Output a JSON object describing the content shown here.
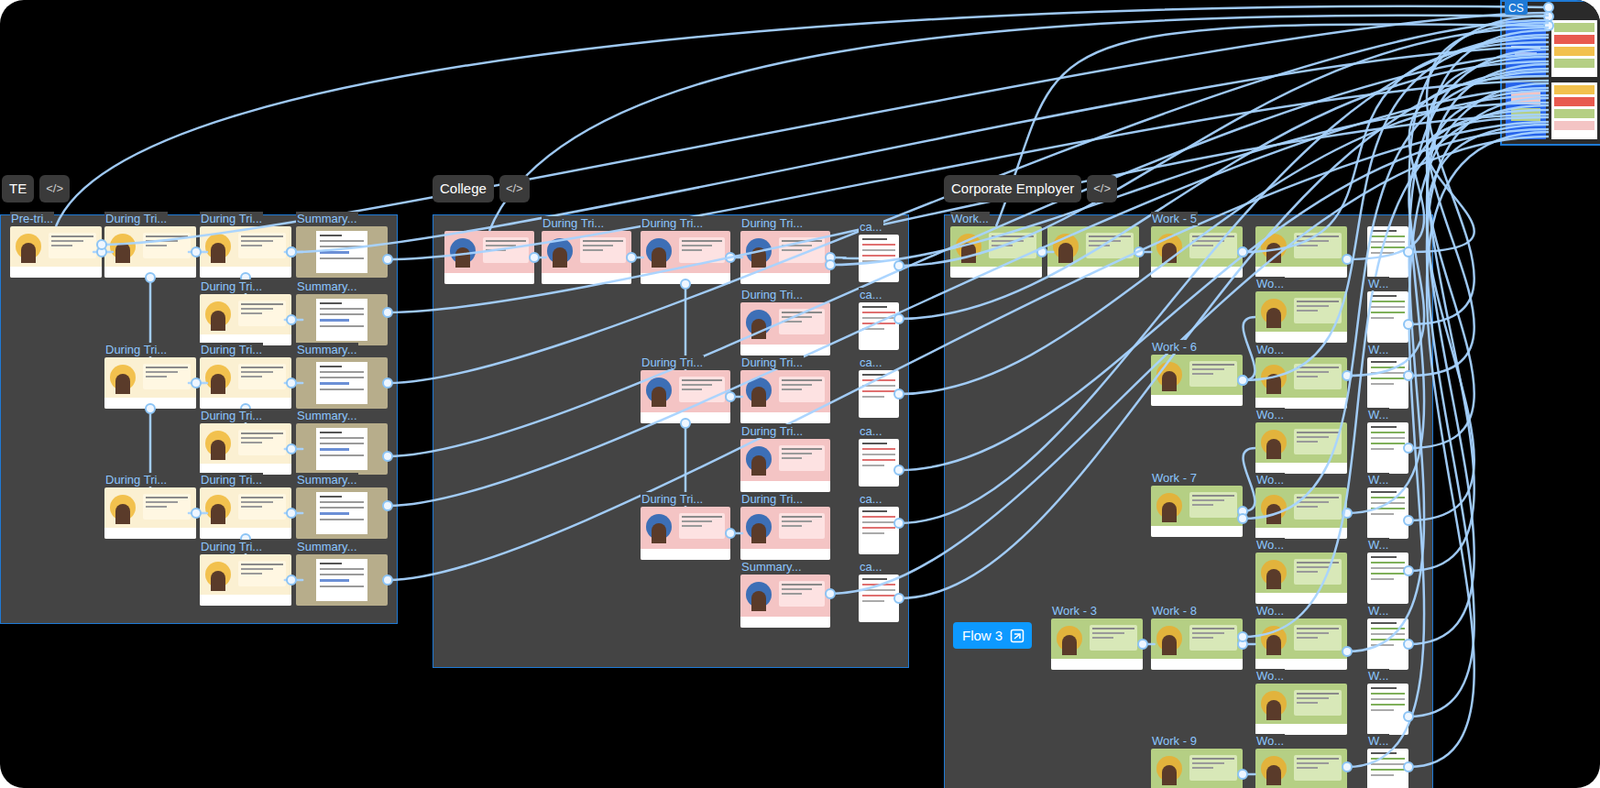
{
  "cs_frame": {
    "label": "CS"
  },
  "badge": {
    "label": "Flow 3"
  },
  "sections": [
    {
      "id": "te",
      "label": "TE",
      "code_icon": "</>",
      "frames": [
        {
          "label": "Pre-tri...",
          "kind": "scene"
        },
        {
          "label": "During Tri...",
          "kind": "scene"
        },
        {
          "label": "During Tri...",
          "kind": "scene"
        },
        {
          "label": "Summary...",
          "kind": "summary"
        },
        {
          "label": "During Tri...",
          "kind": "scene"
        },
        {
          "label": "Summary...",
          "kind": "summary"
        },
        {
          "label": "During Tri...",
          "kind": "scene"
        },
        {
          "label": "During Tri...",
          "kind": "scene"
        },
        {
          "label": "Summary...",
          "kind": "summary"
        },
        {
          "label": "During Tri...",
          "kind": "scene"
        },
        {
          "label": "Summary...",
          "kind": "summary"
        },
        {
          "label": "During Tri...",
          "kind": "scene"
        },
        {
          "label": "During Tri...",
          "kind": "scene"
        },
        {
          "label": "Summary...",
          "kind": "summary"
        },
        {
          "label": "During Tri...",
          "kind": "scene"
        },
        {
          "label": "Summary...",
          "kind": "summary"
        }
      ]
    },
    {
      "id": "college",
      "label": "College",
      "code_icon": "</>",
      "frames": [
        {
          "kind": "scene"
        },
        {
          "label": "During Tri...",
          "kind": "scene"
        },
        {
          "label": "During Tri...",
          "kind": "scene"
        },
        {
          "label": "During Tri...",
          "kind": "scene"
        },
        {
          "label": "ca...",
          "kind": "card"
        },
        {
          "label": "During Tri...",
          "kind": "scene"
        },
        {
          "label": "During Tri...",
          "kind": "scene"
        },
        {
          "label": "During Tri...",
          "kind": "scene"
        },
        {
          "label": "During Tri...",
          "kind": "scene"
        },
        {
          "label": "During Tri...",
          "kind": "scene"
        },
        {
          "label": "During Tri...",
          "kind": "scene"
        },
        {
          "label": "Summary...",
          "kind": "scene"
        },
        {
          "label": "ca...",
          "kind": "card"
        },
        {
          "label": "ca...",
          "kind": "card"
        },
        {
          "label": "ca...",
          "kind": "card"
        },
        {
          "label": "ca...",
          "kind": "card"
        },
        {
          "label": "ca...",
          "kind": "card"
        }
      ]
    },
    {
      "id": "corporate",
      "label": "Corporate Employer",
      "code_icon": "</>",
      "frames": [
        {
          "label": "Work...",
          "kind": "scene"
        },
        {
          "kind": "scene"
        },
        {
          "label": "Work - 5",
          "kind": "scene"
        },
        {
          "kind": "scene"
        },
        {
          "label": "Wo...",
          "kind": "scene"
        },
        {
          "label": "Wo...",
          "kind": "scene"
        },
        {
          "label": "Wo...",
          "kind": "scene"
        },
        {
          "label": "Wo...",
          "kind": "scene"
        },
        {
          "label": "Wo...",
          "kind": "scene"
        },
        {
          "label": "Wo...",
          "kind": "scene"
        },
        {
          "label": "Wo...",
          "kind": "scene"
        },
        {
          "label": "Wo...",
          "kind": "scene"
        },
        {
          "kind": "card"
        },
        {
          "label": "W...",
          "kind": "card"
        },
        {
          "label": "W...",
          "kind": "card"
        },
        {
          "label": "W...",
          "kind": "card"
        },
        {
          "label": "W...",
          "kind": "card"
        },
        {
          "label": "W...",
          "kind": "card"
        },
        {
          "label": "W...",
          "kind": "card"
        },
        {
          "label": "W...",
          "kind": "card"
        },
        {
          "label": "W...",
          "kind": "card"
        },
        {
          "label": "Work - 6",
          "kind": "scene"
        },
        {
          "label": "Work - 7",
          "kind": "scene"
        },
        {
          "label": "Work - 3",
          "kind": "scene"
        },
        {
          "label": "Work - 8",
          "kind": "scene"
        },
        {
          "label": "Work - 9",
          "kind": "scene"
        }
      ]
    }
  ],
  "connections": [
    {
      "from": "cs",
      "to": "te.0"
    },
    {
      "from": "cs",
      "to": "college.0"
    },
    {
      "from": "cs",
      "to": "corporate.0"
    },
    {
      "from": "te.0",
      "to": "te.1"
    },
    {
      "from": "te.1",
      "to": "te.2"
    },
    {
      "from": "te.2",
      "to": "te.3"
    },
    {
      "from": "te.2",
      "to": "te.4"
    },
    {
      "from": "te.4",
      "to": "te.5"
    },
    {
      "from": "te.1",
      "to": "te.6"
    },
    {
      "from": "te.6",
      "to": "te.7"
    },
    {
      "from": "te.7",
      "to": "te.8"
    },
    {
      "from": "te.7",
      "to": "te.9"
    },
    {
      "from": "te.9",
      "to": "te.10"
    },
    {
      "from": "te.6",
      "to": "te.11"
    },
    {
      "from": "te.11",
      "to": "te.12"
    },
    {
      "from": "te.12",
      "to": "te.13"
    },
    {
      "from": "te.12",
      "to": "te.14"
    },
    {
      "from": "te.14",
      "to": "te.15"
    },
    {
      "from": "college.0",
      "to": "college.1"
    },
    {
      "from": "college.1",
      "to": "college.2"
    },
    {
      "from": "college.2",
      "to": "college.3"
    },
    {
      "from": "college.3",
      "to": "college.4"
    },
    {
      "from": "college.2",
      "to": "college.6"
    },
    {
      "from": "college.6",
      "to": "college.7"
    },
    {
      "from": "college.6",
      "to": "college.9"
    },
    {
      "from": "college.9",
      "to": "college.10"
    },
    {
      "from": "corporate.0",
      "to": "corporate.1"
    },
    {
      "from": "corporate.1",
      "to": "corporate.2"
    },
    {
      "from": "corporate.2",
      "to": "corporate.3"
    },
    {
      "from": "corporate.21",
      "to": "corporate.4"
    },
    {
      "from": "corporate.22",
      "to": "corporate.6"
    },
    {
      "from": "corporate.23",
      "to": "corporate.24"
    },
    {
      "from": "corporate.24",
      "to": "corporate.9"
    },
    {
      "from": "corporate.25",
      "to": "corporate.11"
    },
    {
      "from": "te.0",
      "to": "cs"
    },
    {
      "from": "te.2",
      "to": "cs"
    },
    {
      "from": "te.3",
      "to": "cs"
    },
    {
      "from": "te.5",
      "to": "cs"
    },
    {
      "from": "te.8",
      "to": "cs"
    },
    {
      "from": "te.10",
      "to": "cs"
    },
    {
      "from": "te.13",
      "to": "cs"
    },
    {
      "from": "te.15",
      "to": "cs"
    },
    {
      "from": "college.4",
      "to": "cs"
    },
    {
      "from": "college.12",
      "to": "cs"
    },
    {
      "from": "college.13",
      "to": "cs"
    },
    {
      "from": "college.14",
      "to": "cs"
    },
    {
      "from": "college.15",
      "to": "cs"
    },
    {
      "from": "college.16",
      "to": "cs"
    },
    {
      "from": "college.3",
      "to": "cs"
    },
    {
      "from": "college.11",
      "to": "cs"
    },
    {
      "from": "corporate.2",
      "to": "cs"
    },
    {
      "from": "corporate.3",
      "to": "cs"
    },
    {
      "from": "corporate.5",
      "to": "cs"
    },
    {
      "from": "corporate.7",
      "to": "cs"
    },
    {
      "from": "corporate.9",
      "to": "cs"
    },
    {
      "from": "corporate.11",
      "to": "cs"
    },
    {
      "from": "corporate.12",
      "to": "cs"
    },
    {
      "from": "corporate.13",
      "to": "cs"
    },
    {
      "from": "corporate.14",
      "to": "cs"
    },
    {
      "from": "corporate.15",
      "to": "cs"
    },
    {
      "from": "corporate.16",
      "to": "cs"
    },
    {
      "from": "corporate.17",
      "to": "cs"
    },
    {
      "from": "corporate.18",
      "to": "cs"
    },
    {
      "from": "corporate.19",
      "to": "cs"
    },
    {
      "from": "corporate.20",
      "to": "cs"
    },
    {
      "from": "corporate.21",
      "to": "cs"
    },
    {
      "from": "corporate.22",
      "to": "cs"
    },
    {
      "from": "corporate.24",
      "to": "cs"
    }
  ]
}
